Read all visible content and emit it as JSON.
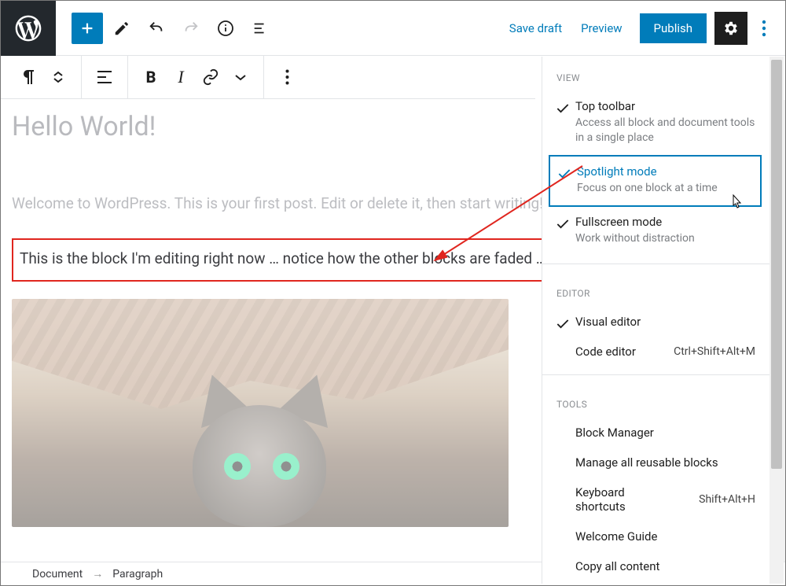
{
  "topbar": {
    "save_draft": "Save draft",
    "preview": "Preview",
    "publish": "Publish"
  },
  "content": {
    "title": "Hello World!",
    "intro": "Welcome to WordPress. This is your first post. Edit or delete it, then start writing!",
    "active_paragraph": "This is the block I'm editing right now … notice how the other blocks are faded … that's Spotlight Mode!"
  },
  "breadcrumb": {
    "root": "Document",
    "current": "Paragraph"
  },
  "panel": {
    "sections": {
      "view": "VIEW",
      "editor": "EDITOR",
      "tools": "TOOLS"
    },
    "view_items": [
      {
        "label": "Top toolbar",
        "desc": "Access all block and document tools in a single place",
        "checked": true
      },
      {
        "label": "Spotlight mode",
        "desc": "Focus on one block at a time",
        "checked": true,
        "selected": true
      },
      {
        "label": "Fullscreen mode",
        "desc": "Work without distraction",
        "checked": true
      }
    ],
    "editor_items": [
      {
        "label": "Visual editor",
        "checked": true
      },
      {
        "label": "Code editor",
        "shortcut": "Ctrl+Shift+Alt+M"
      }
    ],
    "tools_items": [
      {
        "label": "Block Manager"
      },
      {
        "label": "Manage all reusable blocks"
      },
      {
        "label": "Keyboard shortcuts",
        "shortcut": "Shift+Alt+H"
      },
      {
        "label": "Welcome Guide"
      },
      {
        "label": "Copy all content"
      }
    ]
  }
}
